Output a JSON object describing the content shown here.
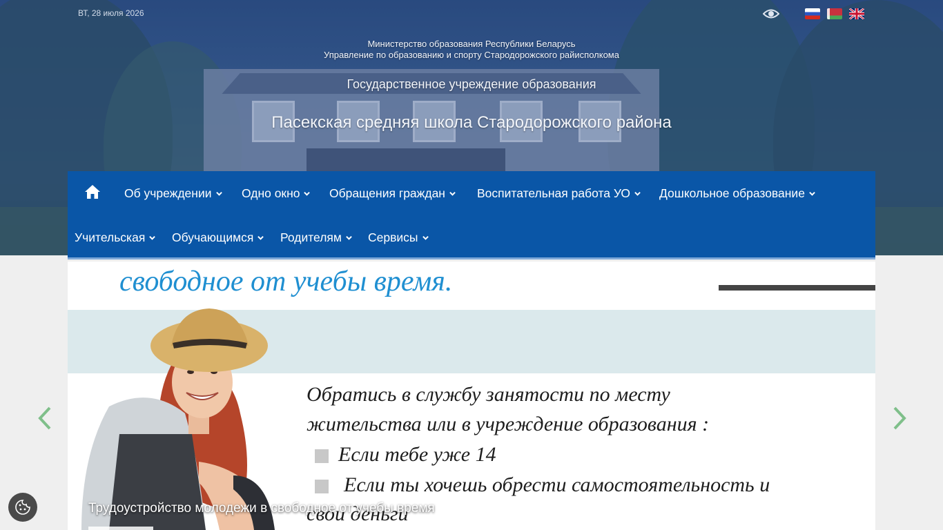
{
  "header": {
    "date": "ВТ, 28 июля 2026",
    "ministry_line1": "Министерство образования Республики Беларусь",
    "ministry_line2": "Управление по образованию и спорту Стародорожского райисполкома",
    "org_type": "Государственное учреждение образования",
    "school_name": "Пасекская средняя школа Стародорожского района",
    "icons": [
      "eye-icon",
      "flag-ru-icon",
      "flag-by-icon",
      "flag-gb-icon"
    ]
  },
  "nav": {
    "home_icon": "home-icon",
    "row1": [
      "Об учреждении",
      "Одно окно",
      "Обращения граждан",
      "Воспитательная работа УО",
      "Дошкольное образование"
    ],
    "row2": [
      "Учительская",
      "Обучающимся",
      "Родителям",
      "Сервисы"
    ],
    "colors": {
      "background": "#0a56a7",
      "text": "#ffffff"
    }
  },
  "slider": {
    "headline": "свободное от учебы время.",
    "text_line1": "Обратись в службу занятости по месту",
    "text_line2": "жительства или в учреждение образования :",
    "bullet1": "Если тебе уже 14",
    "bullet2": "Если ты хочешь обрести самостоятельность и",
    "text_line5": "свои деньги",
    "caption": "Трудоустройство молодежи в свободное от учебы время",
    "prev_icon": "chevron-left-icon",
    "next_icon": "chevron-right-icon",
    "arrow_color": "#7fbf8a"
  },
  "widgets": {
    "cookie_icon": "cookie-icon"
  }
}
